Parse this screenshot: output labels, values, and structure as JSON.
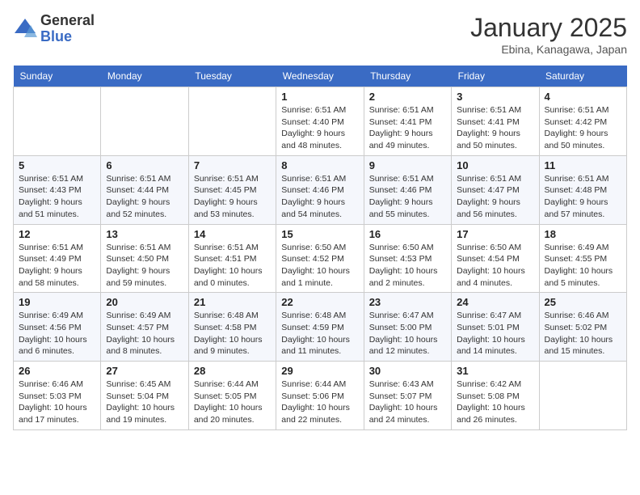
{
  "header": {
    "logo_general": "General",
    "logo_blue": "Blue",
    "month_title": "January 2025",
    "location": "Ebina, Kanagawa, Japan"
  },
  "days_of_week": [
    "Sunday",
    "Monday",
    "Tuesday",
    "Wednesday",
    "Thursday",
    "Friday",
    "Saturday"
  ],
  "weeks": [
    [
      {
        "day": "",
        "info": ""
      },
      {
        "day": "",
        "info": ""
      },
      {
        "day": "",
        "info": ""
      },
      {
        "day": "1",
        "info": "Sunrise: 6:51 AM\nSunset: 4:40 PM\nDaylight: 9 hours and 48 minutes."
      },
      {
        "day": "2",
        "info": "Sunrise: 6:51 AM\nSunset: 4:41 PM\nDaylight: 9 hours and 49 minutes."
      },
      {
        "day": "3",
        "info": "Sunrise: 6:51 AM\nSunset: 4:41 PM\nDaylight: 9 hours and 50 minutes."
      },
      {
        "day": "4",
        "info": "Sunrise: 6:51 AM\nSunset: 4:42 PM\nDaylight: 9 hours and 50 minutes."
      }
    ],
    [
      {
        "day": "5",
        "info": "Sunrise: 6:51 AM\nSunset: 4:43 PM\nDaylight: 9 hours and 51 minutes."
      },
      {
        "day": "6",
        "info": "Sunrise: 6:51 AM\nSunset: 4:44 PM\nDaylight: 9 hours and 52 minutes."
      },
      {
        "day": "7",
        "info": "Sunrise: 6:51 AM\nSunset: 4:45 PM\nDaylight: 9 hours and 53 minutes."
      },
      {
        "day": "8",
        "info": "Sunrise: 6:51 AM\nSunset: 4:46 PM\nDaylight: 9 hours and 54 minutes."
      },
      {
        "day": "9",
        "info": "Sunrise: 6:51 AM\nSunset: 4:46 PM\nDaylight: 9 hours and 55 minutes."
      },
      {
        "day": "10",
        "info": "Sunrise: 6:51 AM\nSunset: 4:47 PM\nDaylight: 9 hours and 56 minutes."
      },
      {
        "day": "11",
        "info": "Sunrise: 6:51 AM\nSunset: 4:48 PM\nDaylight: 9 hours and 57 minutes."
      }
    ],
    [
      {
        "day": "12",
        "info": "Sunrise: 6:51 AM\nSunset: 4:49 PM\nDaylight: 9 hours and 58 minutes."
      },
      {
        "day": "13",
        "info": "Sunrise: 6:51 AM\nSunset: 4:50 PM\nDaylight: 9 hours and 59 minutes."
      },
      {
        "day": "14",
        "info": "Sunrise: 6:51 AM\nSunset: 4:51 PM\nDaylight: 10 hours and 0 minutes."
      },
      {
        "day": "15",
        "info": "Sunrise: 6:50 AM\nSunset: 4:52 PM\nDaylight: 10 hours and 1 minute."
      },
      {
        "day": "16",
        "info": "Sunrise: 6:50 AM\nSunset: 4:53 PM\nDaylight: 10 hours and 2 minutes."
      },
      {
        "day": "17",
        "info": "Sunrise: 6:50 AM\nSunset: 4:54 PM\nDaylight: 10 hours and 4 minutes."
      },
      {
        "day": "18",
        "info": "Sunrise: 6:49 AM\nSunset: 4:55 PM\nDaylight: 10 hours and 5 minutes."
      }
    ],
    [
      {
        "day": "19",
        "info": "Sunrise: 6:49 AM\nSunset: 4:56 PM\nDaylight: 10 hours and 6 minutes."
      },
      {
        "day": "20",
        "info": "Sunrise: 6:49 AM\nSunset: 4:57 PM\nDaylight: 10 hours and 8 minutes."
      },
      {
        "day": "21",
        "info": "Sunrise: 6:48 AM\nSunset: 4:58 PM\nDaylight: 10 hours and 9 minutes."
      },
      {
        "day": "22",
        "info": "Sunrise: 6:48 AM\nSunset: 4:59 PM\nDaylight: 10 hours and 11 minutes."
      },
      {
        "day": "23",
        "info": "Sunrise: 6:47 AM\nSunset: 5:00 PM\nDaylight: 10 hours and 12 minutes."
      },
      {
        "day": "24",
        "info": "Sunrise: 6:47 AM\nSunset: 5:01 PM\nDaylight: 10 hours and 14 minutes."
      },
      {
        "day": "25",
        "info": "Sunrise: 6:46 AM\nSunset: 5:02 PM\nDaylight: 10 hours and 15 minutes."
      }
    ],
    [
      {
        "day": "26",
        "info": "Sunrise: 6:46 AM\nSunset: 5:03 PM\nDaylight: 10 hours and 17 minutes."
      },
      {
        "day": "27",
        "info": "Sunrise: 6:45 AM\nSunset: 5:04 PM\nDaylight: 10 hours and 19 minutes."
      },
      {
        "day": "28",
        "info": "Sunrise: 6:44 AM\nSunset: 5:05 PM\nDaylight: 10 hours and 20 minutes."
      },
      {
        "day": "29",
        "info": "Sunrise: 6:44 AM\nSunset: 5:06 PM\nDaylight: 10 hours and 22 minutes."
      },
      {
        "day": "30",
        "info": "Sunrise: 6:43 AM\nSunset: 5:07 PM\nDaylight: 10 hours and 24 minutes."
      },
      {
        "day": "31",
        "info": "Sunrise: 6:42 AM\nSunset: 5:08 PM\nDaylight: 10 hours and 26 minutes."
      },
      {
        "day": "",
        "info": ""
      }
    ]
  ]
}
